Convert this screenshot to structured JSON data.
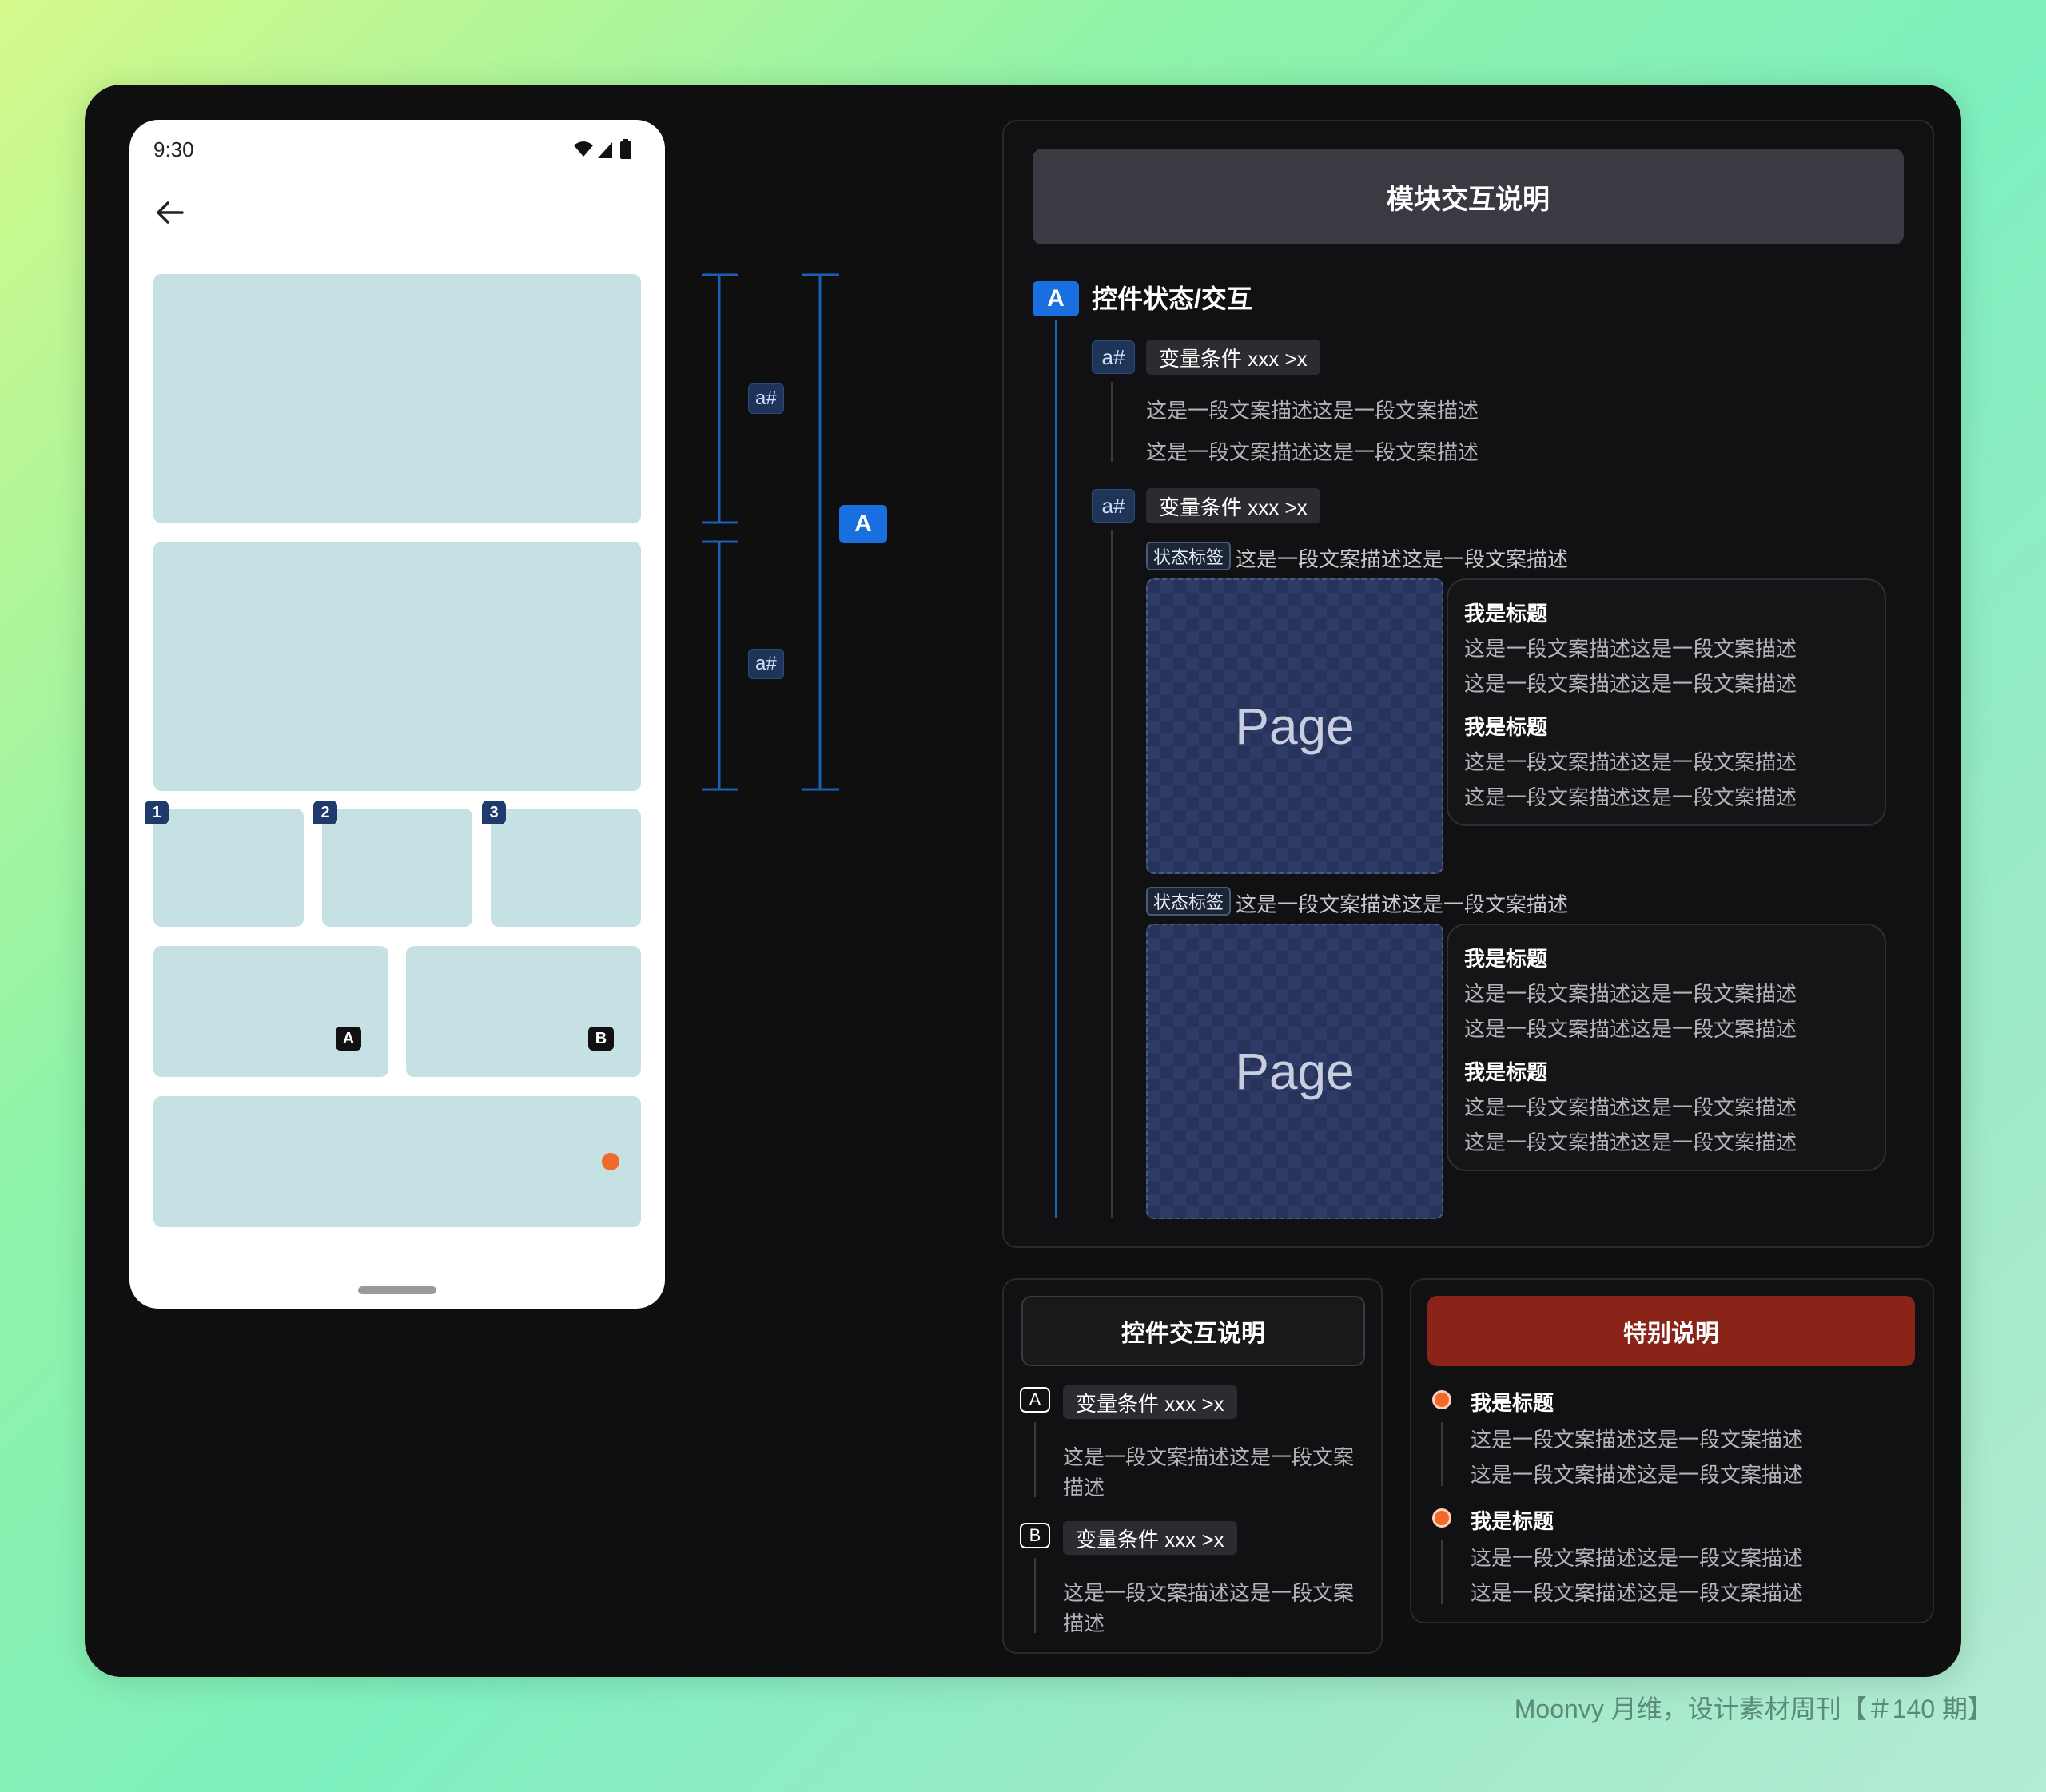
{
  "phone": {
    "time": "9:30",
    "block_badges": [
      "1",
      "2",
      "3"
    ],
    "letter_badges": [
      "A",
      "B"
    ]
  },
  "measure": {
    "hash_label": "a#",
    "section_label": "A"
  },
  "main_panel": {
    "title": "模块交互说明",
    "section": {
      "badge": "A",
      "title": "控件状态/交互"
    },
    "items": [
      {
        "badge": "a#",
        "condition": "变量条件 xxx >x",
        "lines": [
          "这是一段文案描述这是一段文案描述",
          "这是一段文案描述这是一段文案描述"
        ]
      },
      {
        "badge": "a#",
        "condition": "变量条件 xxx >x",
        "states": [
          {
            "tag": "状态标签",
            "desc": "这是一段文案描述这是一段文案描述",
            "page_label": "Page",
            "card": {
              "title1": "我是标题",
              "desc1a": "这是一段文案描述这是一段文案描述",
              "desc1b": "这是一段文案描述这是一段文案描述",
              "title2": "我是标题",
              "desc2a": "这是一段文案描述这是一段文案描述",
              "desc2b": "这是一段文案描述这是一段文案描述"
            }
          },
          {
            "tag": "状态标签",
            "desc": "这是一段文案描述这是一段文案描述",
            "page_label": "Page",
            "card": {
              "title1": "我是标题",
              "desc1a": "这是一段文案描述这是一段文案描述",
              "desc1b": "这是一段文案描述这是一段文案描述",
              "title2": "我是标题",
              "desc2a": "这是一段文案描述这是一段文案描述",
              "desc2b": "这是一段文案描述这是一段文案描述"
            }
          }
        ]
      }
    ]
  },
  "control_panel": {
    "title": "控件交互说明",
    "items": [
      {
        "badge": "A",
        "condition": "变量条件 xxx >x",
        "line1": "这是一段文案描述这是一段文案",
        "line2": "描述"
      },
      {
        "badge": "B",
        "condition": "变量条件 xxx >x",
        "line1": "这是一段文案描述这是一段文案",
        "line2": "描述"
      }
    ]
  },
  "special_panel": {
    "title": "特别说明",
    "items": [
      {
        "title": "我是标题",
        "line1": "这是一段文案描述这是一段文案描述",
        "line2": "这是一段文案描述这是一段文案描述"
      },
      {
        "title": "我是标题",
        "line1": "这是一段文案描述这是一段文案描述",
        "line2": "这是一段文案描述这是一段文案描述"
      }
    ]
  },
  "watermark": "Moonvy 月维，设计素材周刊【＃140 期】",
  "colors": {
    "accent_blue": "#1a6fe0",
    "special_red": "#8a2418",
    "bullet_orange": "#f26a2a",
    "block_fill": "#c5e1e3"
  },
  "icons": [
    "back-arrow-icon",
    "wifi-icon",
    "signal-icon",
    "battery-icon"
  ]
}
